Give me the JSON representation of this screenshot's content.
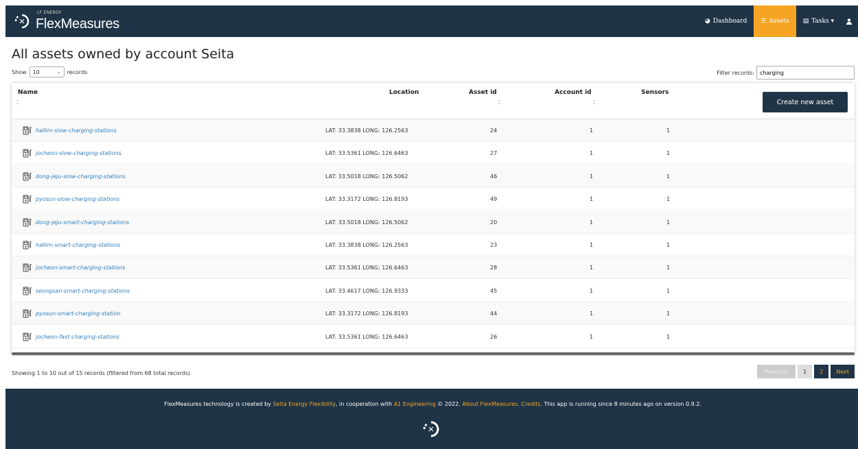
{
  "brand": {
    "sub": "LF ENERGY",
    "name": "FlexMeasures"
  },
  "nav": {
    "items": [
      {
        "label": "Dashboard",
        "icon": "dashboard-icon"
      },
      {
        "label": "Assets",
        "icon": "list-icon",
        "active": true
      },
      {
        "label": "Tasks ▾",
        "icon": "tasks-icon"
      }
    ],
    "user_icon": "user-icon"
  },
  "page": {
    "title": "All assets owned by account Seita"
  },
  "length": {
    "prefix": "Show",
    "value": "10",
    "suffix": "records"
  },
  "filter": {
    "label": "Filter records:",
    "value": "charging"
  },
  "table": {
    "headers": {
      "name": "Name",
      "location": "Location",
      "asset_id": "Asset id",
      "account_id": "Account id",
      "sensors": "Sensors"
    },
    "create_button": "Create new asset",
    "rows": [
      {
        "name": "hallim-slow-charging-stations",
        "location": "LAT: 33.3838 LONG: 126.2563",
        "asset_id": "24",
        "account_id": "1",
        "sensors": "1"
      },
      {
        "name": "jocheon-slow-charging-stations",
        "location": "LAT: 33.5361 LONG: 126.6463",
        "asset_id": "27",
        "account_id": "1",
        "sensors": "1"
      },
      {
        "name": "dong-jeju-slow-charging-stations",
        "location": "LAT: 33.5018 LONG: 126.5062",
        "asset_id": "46",
        "account_id": "1",
        "sensors": "1"
      },
      {
        "name": "pyosun-slow-charging-stations",
        "location": "LAT: 33.3172 LONG: 126.8193",
        "asset_id": "49",
        "account_id": "1",
        "sensors": "1"
      },
      {
        "name": "dong-jeju-smart-charging-stations",
        "location": "LAT: 33.5018 LONG: 126.5062",
        "asset_id": "20",
        "account_id": "1",
        "sensors": "1"
      },
      {
        "name": "hallim-smart-charging-stations",
        "location": "LAT: 33.3838 LONG: 126.2563",
        "asset_id": "23",
        "account_id": "1",
        "sensors": "1"
      },
      {
        "name": "jocheon-smart-charging-stations",
        "location": "LAT: 33.5361 LONG: 126.6463",
        "asset_id": "28",
        "account_id": "1",
        "sensors": "1"
      },
      {
        "name": "seongsan-smart-charging-stations",
        "location": "LAT: 33.4617 LONG: 126.9333",
        "asset_id": "45",
        "account_id": "1",
        "sensors": "1"
      },
      {
        "name": "pyosun-smart-charging-station",
        "location": "LAT: 33.3172 LONG: 126.8193",
        "asset_id": "44",
        "account_id": "1",
        "sensors": "1"
      },
      {
        "name": "jocheon-fast-charging-stations",
        "location": "LAT: 33.5361 LONG: 126.6463",
        "asset_id": "26",
        "account_id": "1",
        "sensors": "1"
      }
    ]
  },
  "info": "Showing 1 to 10 out of 15 records (filtered from 68 total records)",
  "pager": {
    "prev": "Previous",
    "p1": "1",
    "p2": "2",
    "next": "Next"
  },
  "footer": {
    "t1": "FlexMeasures technology is created by ",
    "l1": "Seita Energy Flexibility",
    "t2": ", in cooperation with ",
    "l2": "A1 Engineering",
    "t3": " © 2022. ",
    "l3": "About FlexMeasures",
    "t4": ". ",
    "l4": "Credits",
    "t5": ". This app is running since 8 minutes ago on version 0.9.2."
  },
  "colors": {
    "navbar": "#1f3446",
    "accent": "#f5a523",
    "link": "#2f7fbf"
  }
}
